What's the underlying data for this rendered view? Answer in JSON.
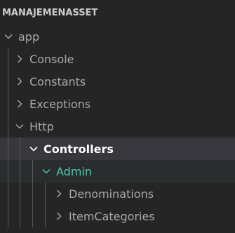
{
  "explorer": {
    "section_title": "MANAJEMENASSET",
    "tree": {
      "app": "app",
      "console": "Console",
      "constants": "Constants",
      "exceptions": "Exceptions",
      "http": "Http",
      "controllers": "Controllers",
      "admin": "Admin",
      "denominations": "Denominations",
      "item_categories": "ItemCategories"
    },
    "icons": {
      "expanded": "chevron-down-icon",
      "collapsed": "chevron-right-icon"
    },
    "colors": {
      "background": "#252526",
      "active_row": "#37373d",
      "selected_text": "#4ec9b0",
      "guide": "#585858"
    }
  }
}
